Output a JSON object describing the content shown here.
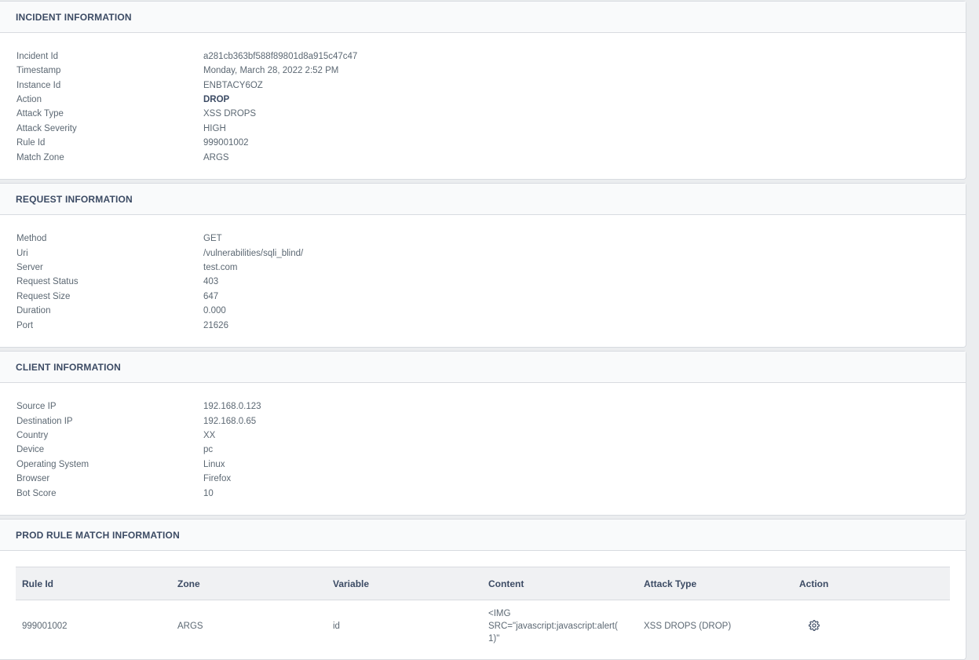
{
  "incident": {
    "title": "INCIDENT INFORMATION",
    "rows": [
      {
        "label": "Incident Id",
        "value": "a281cb363bf588f89801d8a915c47c47"
      },
      {
        "label": "Timestamp",
        "value": "Monday, March 28, 2022 2:52 PM"
      },
      {
        "label": "Instance Id",
        "value": "ENBTACY6OZ"
      },
      {
        "label": "Action",
        "value": "DROP"
      },
      {
        "label": "Attack Type",
        "value": "XSS DROPS"
      },
      {
        "label": "Attack Severity",
        "value": "HIGH"
      },
      {
        "label": "Rule Id",
        "value": "999001002"
      },
      {
        "label": "Match Zone",
        "value": "ARGS"
      }
    ]
  },
  "request": {
    "title": "REQUEST INFORMATION",
    "rows": [
      {
        "label": "Method",
        "value": "GET"
      },
      {
        "label": "Uri",
        "value": "/vulnerabilities/sqli_blind/"
      },
      {
        "label": "Server",
        "value": "test.com"
      },
      {
        "label": "Request Status",
        "value": "403"
      },
      {
        "label": "Request Size",
        "value": "647"
      },
      {
        "label": "Duration",
        "value": "0.000"
      },
      {
        "label": "Port",
        "value": "21626"
      }
    ]
  },
  "client": {
    "title": "CLIENT INFORMATION",
    "rows": [
      {
        "label": "Source IP",
        "value": "192.168.0.123"
      },
      {
        "label": "Destination IP",
        "value": "192.168.0.65"
      },
      {
        "label": "Country",
        "value": "XX"
      },
      {
        "label": "Device",
        "value": "pc"
      },
      {
        "label": "Operating System",
        "value": "Linux"
      },
      {
        "label": "Browser",
        "value": "Firefox"
      },
      {
        "label": "Bot Score",
        "value": "10"
      }
    ]
  },
  "prod_rule": {
    "title": "PROD RULE MATCH INFORMATION",
    "columns": [
      "Rule Id",
      "Zone",
      "Variable",
      "Content",
      "Attack Type",
      "Action"
    ],
    "rows": [
      {
        "rule_id": "999001002",
        "zone": "ARGS",
        "variable": "id",
        "content_lines": [
          "<IMG",
          "SRC=\"javascript:javascript:alert(",
          "1)\""
        ],
        "attack_type": "XSS DROPS (DROP)",
        "action_icon": "gear-icon"
      }
    ]
  }
}
